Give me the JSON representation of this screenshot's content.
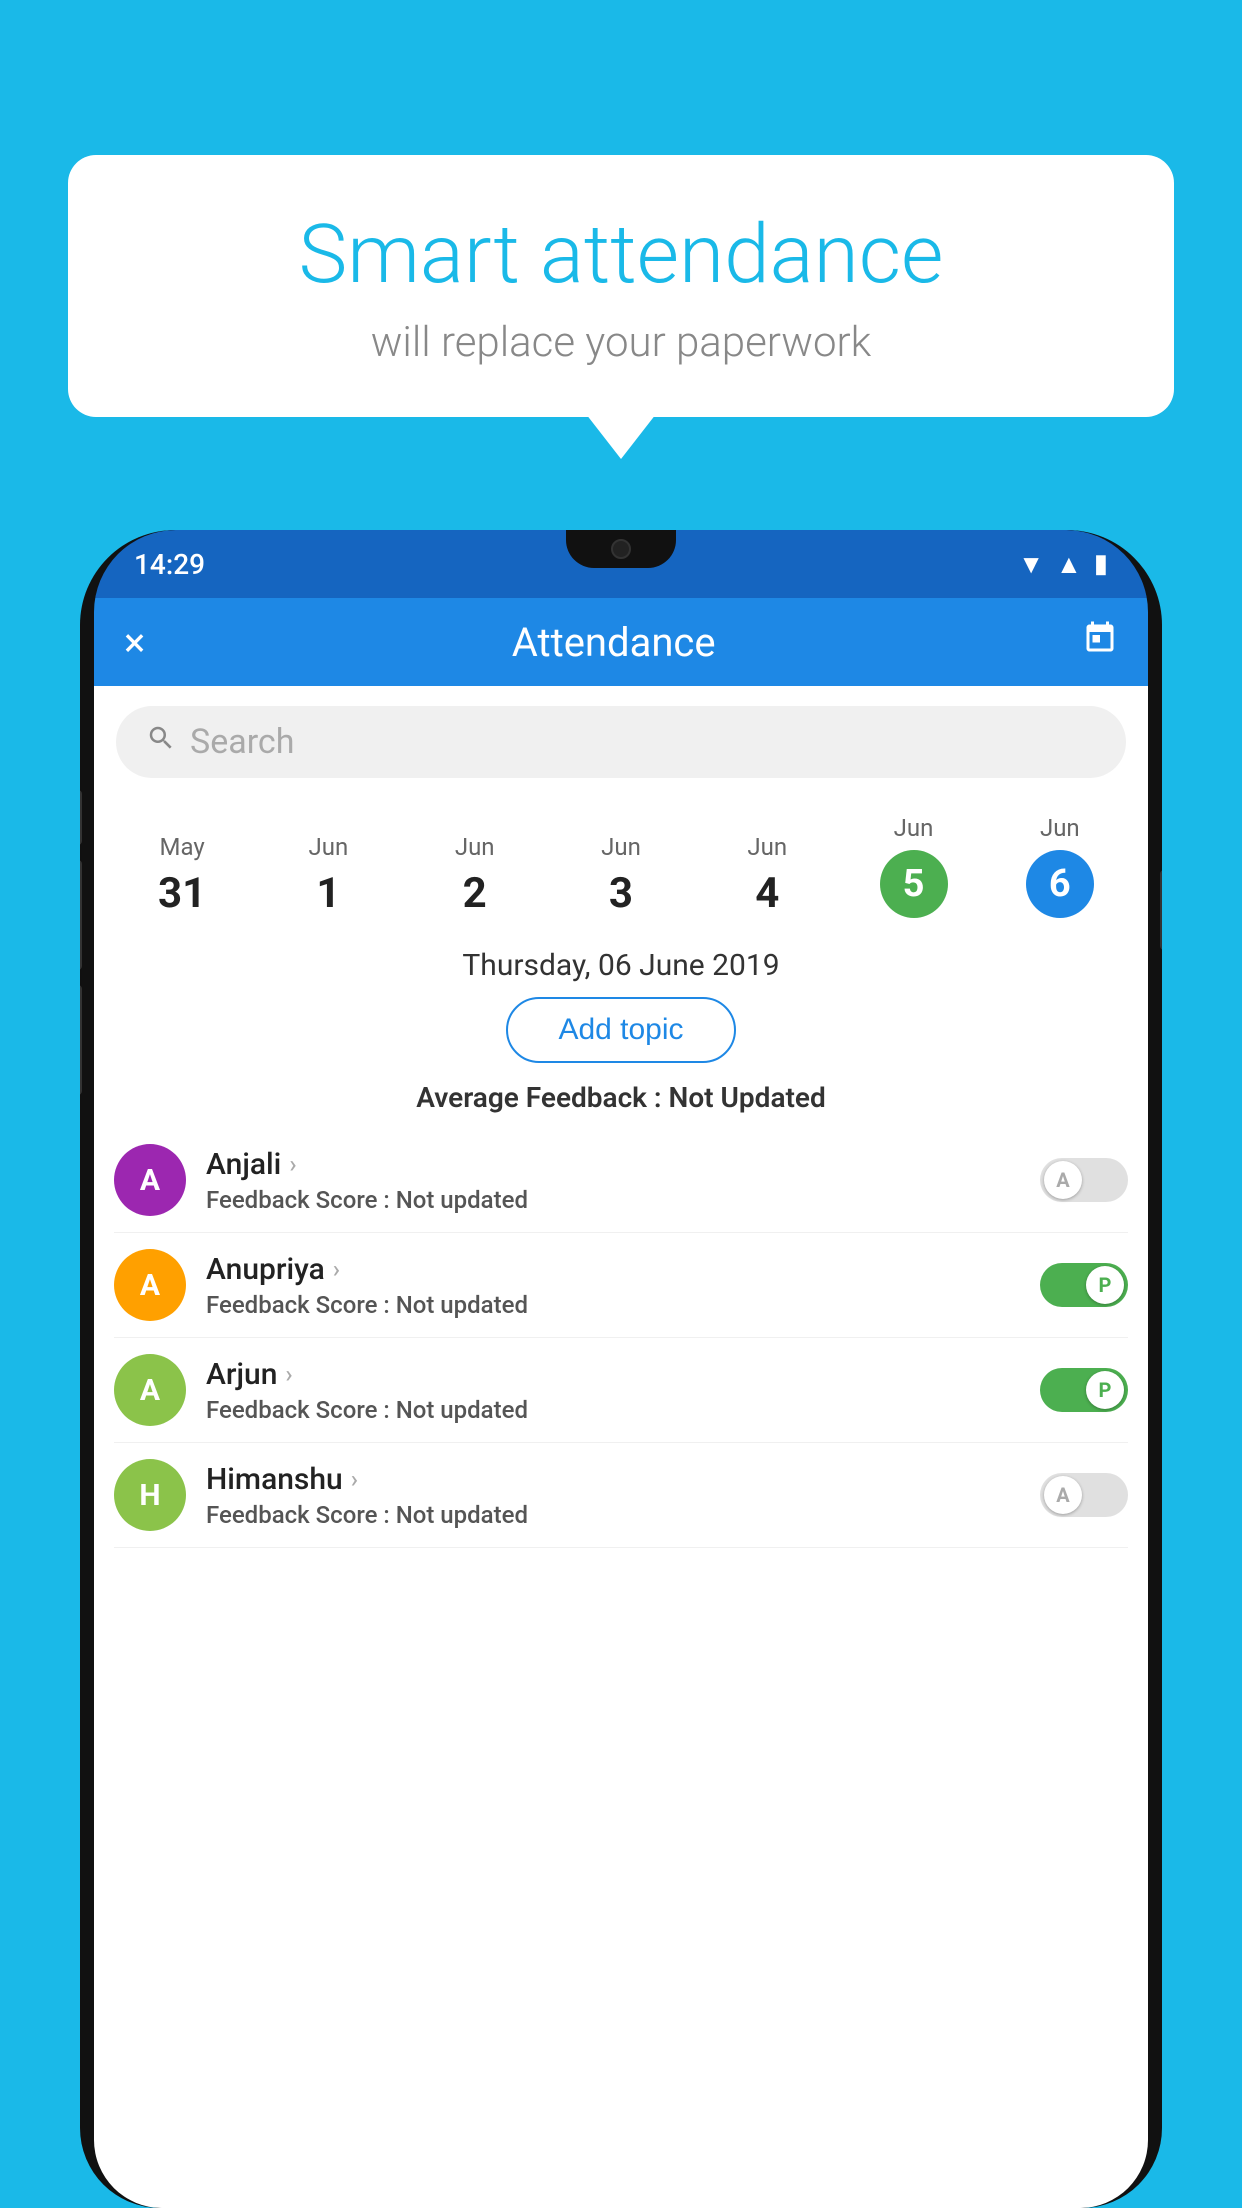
{
  "page": {
    "background_color": "#1ab9e8"
  },
  "speech_bubble": {
    "title": "Smart attendance",
    "subtitle": "will replace your paperwork"
  },
  "status_bar": {
    "time": "14:29",
    "icons": [
      "wifi",
      "signal",
      "battery"
    ]
  },
  "app_bar": {
    "title": "Attendance",
    "close_label": "×",
    "calendar_label": "📅"
  },
  "search": {
    "placeholder": "Search"
  },
  "calendar": {
    "dates": [
      {
        "month": "May",
        "day": "31",
        "state": "normal"
      },
      {
        "month": "Jun",
        "day": "1",
        "state": "normal"
      },
      {
        "month": "Jun",
        "day": "2",
        "state": "normal"
      },
      {
        "month": "Jun",
        "day": "3",
        "state": "normal"
      },
      {
        "month": "Jun",
        "day": "4",
        "state": "normal"
      },
      {
        "month": "Jun",
        "day": "5",
        "state": "active-green"
      },
      {
        "month": "Jun",
        "day": "6",
        "state": "active-blue"
      }
    ],
    "selected_date": "Thursday, 06 June 2019"
  },
  "add_topic": {
    "label": "Add topic"
  },
  "avg_feedback": {
    "label": "Average Feedback : ",
    "value": "Not Updated"
  },
  "students": [
    {
      "name": "Anjali",
      "avatar_letter": "A",
      "avatar_color": "#9c27b0",
      "feedback_label": "Feedback Score : ",
      "feedback_value": "Not updated",
      "toggle_state": "off",
      "toggle_label": "A"
    },
    {
      "name": "Anupriya",
      "avatar_letter": "A",
      "avatar_color": "#ffa000",
      "feedback_label": "Feedback Score : ",
      "feedback_value": "Not updated",
      "toggle_state": "on",
      "toggle_label": "P"
    },
    {
      "name": "Arjun",
      "avatar_letter": "A",
      "avatar_color": "#8bc34a",
      "feedback_label": "Feedback Score : ",
      "feedback_value": "Not updated",
      "toggle_state": "on",
      "toggle_label": "P"
    },
    {
      "name": "Himanshu",
      "avatar_letter": "H",
      "avatar_color": "#8bc34a",
      "feedback_label": "Feedback Score : ",
      "feedback_value": "Not updated",
      "toggle_state": "off",
      "toggle_label": "A"
    }
  ]
}
